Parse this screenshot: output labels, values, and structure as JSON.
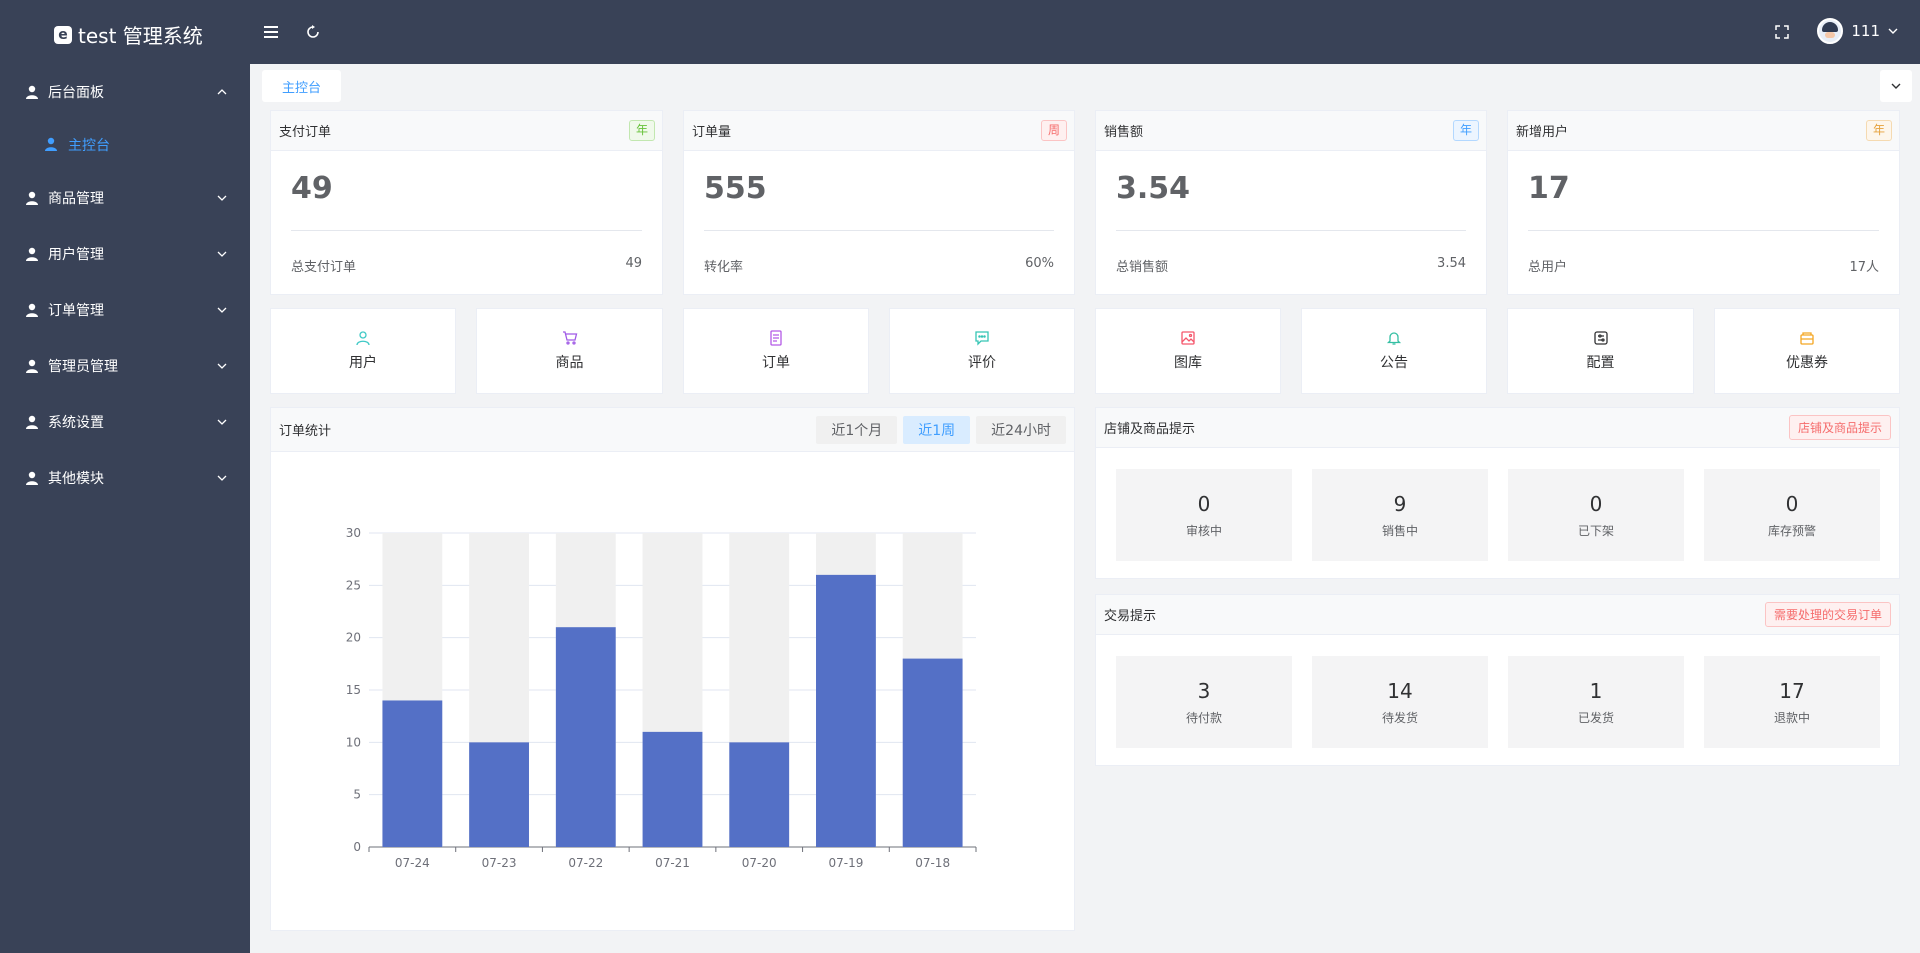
{
  "header": {
    "brand_title": "test 管理系统",
    "brand_logo_letter": "e",
    "user_name": "111"
  },
  "sidebar": {
    "groups": [
      {
        "label": "后台面板",
        "expanded": true,
        "children": [
          "主控台"
        ]
      },
      {
        "label": "商品管理"
      },
      {
        "label": "用户管理"
      },
      {
        "label": "订单管理"
      },
      {
        "label": "管理员管理"
      },
      {
        "label": "系统设置"
      },
      {
        "label": "其他模块"
      }
    ]
  },
  "tabs": {
    "active": "主控台"
  },
  "stats": [
    {
      "title": "支付订单",
      "tag": "年",
      "value": "49",
      "foot_label": "总支付订单",
      "foot_value": "49",
      "tag_color": "#67c23a"
    },
    {
      "title": "订单量",
      "tag": "周",
      "value": "555",
      "foot_label": "转化率",
      "foot_value": "60%",
      "tag_color": "#f56c6c"
    },
    {
      "title": "销售额",
      "tag": "年",
      "value": "3.54",
      "foot_label": "总销售额",
      "foot_value": "3.54",
      "tag_color": "#409eff"
    },
    {
      "title": "新增用户",
      "tag": "年",
      "value": "17",
      "foot_label": "总用户",
      "foot_value": "17人",
      "tag_color": "#e6a23c"
    }
  ],
  "nav_cards": [
    {
      "label": "用户",
      "icon": "user-icon",
      "color": "#40c9c6"
    },
    {
      "label": "商品",
      "icon": "cart-icon",
      "color": "#a05ae6"
    },
    {
      "label": "订单",
      "icon": "document-icon",
      "color": "#b45ae6"
    },
    {
      "label": "评价",
      "icon": "comment-icon",
      "color": "#36c5b5"
    },
    {
      "label": "图库",
      "icon": "picture-icon",
      "color": "#f5576c"
    },
    {
      "label": "公告",
      "icon": "bell-icon",
      "color": "#34bfa3"
    },
    {
      "label": "配置",
      "icon": "settings-icon",
      "color": "#303133"
    },
    {
      "label": "优惠券",
      "icon": "coupon-icon",
      "color": "#f4a623"
    }
  ],
  "order_stats": {
    "title": "订单统计",
    "ranges": [
      "近1个月",
      "近1周",
      "近24小时"
    ],
    "active_range": "近1周"
  },
  "chart_data": {
    "type": "bar",
    "categories": [
      "07-24",
      "07-23",
      "07-22",
      "07-21",
      "07-20",
      "07-19",
      "07-18"
    ],
    "values": [
      14,
      10,
      21,
      11,
      10,
      26,
      18
    ],
    "ylim": [
      0,
      30
    ],
    "yticks": [
      0,
      5,
      10,
      15,
      20,
      25,
      30
    ],
    "title": "",
    "xlabel": "",
    "ylabel": "",
    "bar_color": "#5470c6",
    "background_bar_color": "#f0f0f0"
  },
  "shop_tips": {
    "title": "店铺及商品提示",
    "button": "店铺及商品提示",
    "items": [
      {
        "value": "0",
        "label": "审核中"
      },
      {
        "value": "9",
        "label": "销售中"
      },
      {
        "value": "0",
        "label": "已下架"
      },
      {
        "value": "0",
        "label": "库存预警"
      }
    ]
  },
  "trade_tips": {
    "title": "交易提示",
    "button": "需要处理的交易订单",
    "items": [
      {
        "value": "3",
        "label": "待付款"
      },
      {
        "value": "14",
        "label": "待发货"
      },
      {
        "value": "1",
        "label": "已发货"
      },
      {
        "value": "17",
        "label": "退款中"
      }
    ]
  }
}
